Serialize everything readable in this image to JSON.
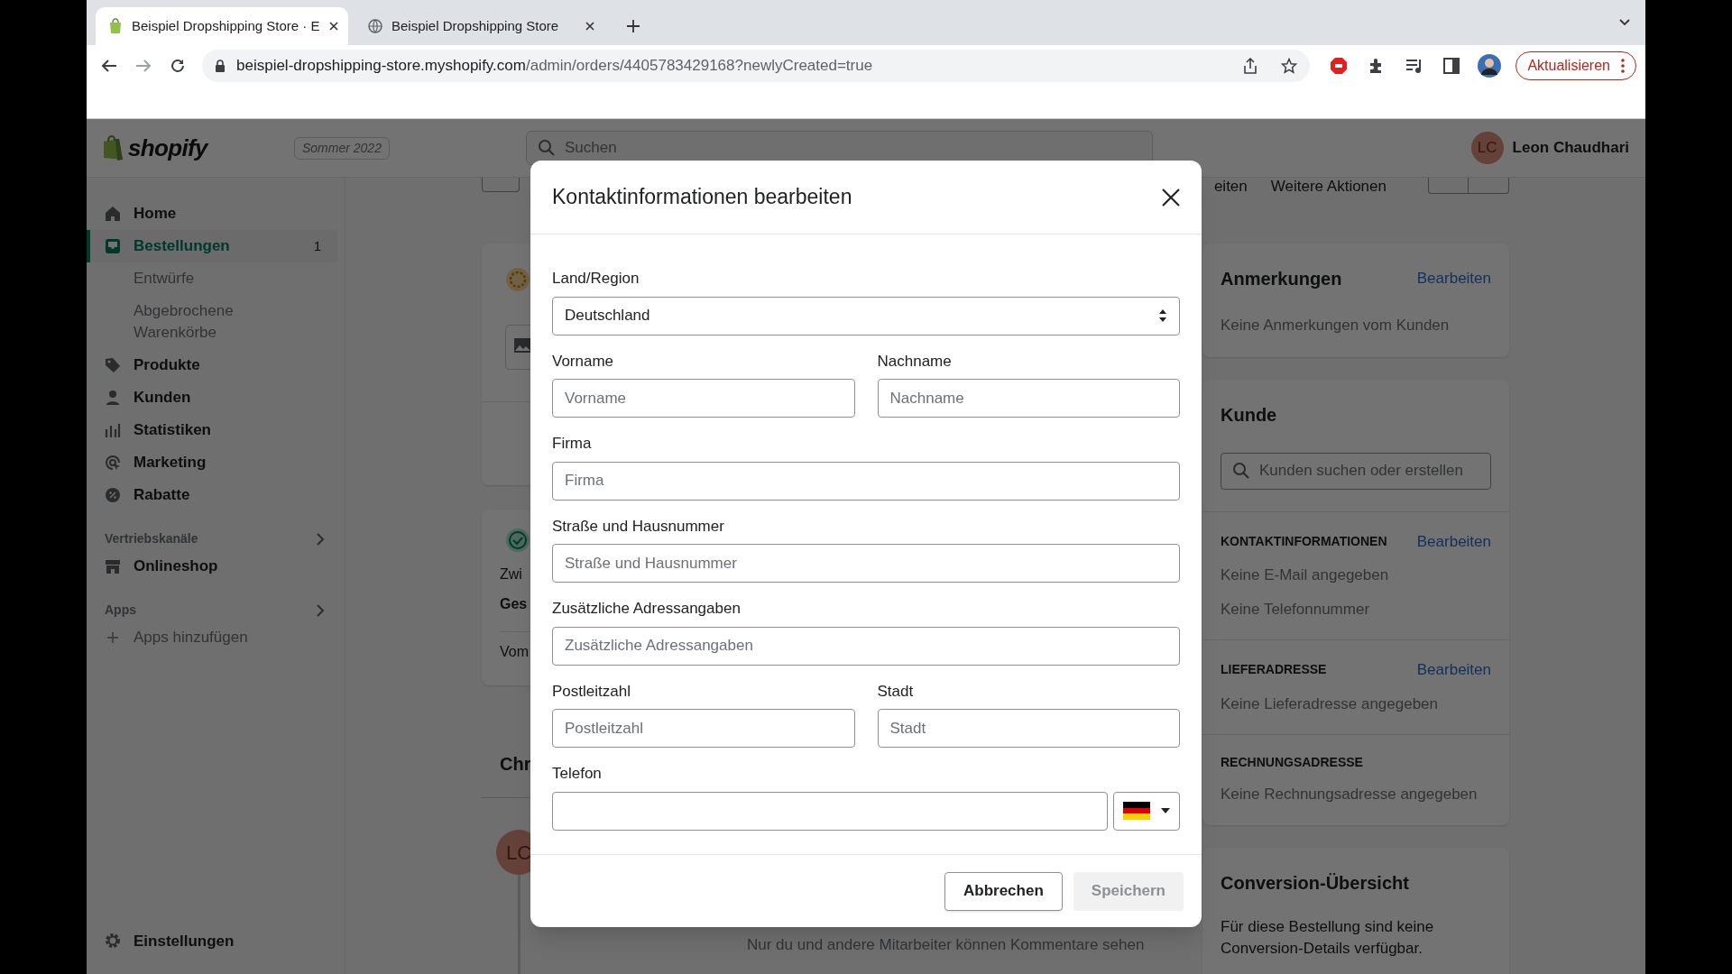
{
  "browser": {
    "tabs": [
      {
        "title": "Beispiel Dropshipping Store · E",
        "selected": true,
        "kind": "shop"
      },
      {
        "title": "Beispiel Dropshipping Store",
        "selected": false,
        "kind": "web"
      }
    ],
    "url_host": "beispiel-dropshipping-store.myshopify.com",
    "url_path": "/admin/orders/4405783429168?newlyCreated=true",
    "update_button": "Aktualisieren"
  },
  "topbar": {
    "logo": "shopify",
    "badge": "Sommer 2022",
    "search_placeholder": "Suchen",
    "user_initials": "LC",
    "user_name": "Leon Chaudhari"
  },
  "sidebar": {
    "items": [
      {
        "label": "Home",
        "selected": false
      },
      {
        "label": "Bestellungen",
        "selected": true,
        "badge": "1",
        "children": [
          {
            "label": "Entwürfe",
            "selected": false
          },
          {
            "label": "Abgebrochene Warenkörbe",
            "selected": false
          }
        ]
      },
      {
        "label": "Produkte",
        "selected": false
      },
      {
        "label": "Kunden",
        "selected": false
      },
      {
        "label": "Statistiken",
        "selected": false
      },
      {
        "label": "Marketing",
        "selected": false
      },
      {
        "label": "Rabatte",
        "selected": false
      }
    ],
    "sections": [
      {
        "title": "Vertriebskanäle",
        "items": [
          {
            "label": "Onlineshop",
            "kind": "nav",
            "selected": false
          }
        ]
      },
      {
        "title": "Apps",
        "items": [
          {
            "label": "Apps hinzufügen",
            "kind": "add",
            "selected": false
          }
        ]
      }
    ],
    "settings": "Einstellungen"
  },
  "header_actions": [
    "eiten",
    "Weitere Aktionen"
  ],
  "left_fragments": {
    "card_2": [
      "Zwi",
      "Ges",
      "Vom"
    ],
    "timeline_heading": "Chr",
    "avatar_initials": "LC",
    "comment_hint": "Nur du und andere Mitarbeiter können Kommentare sehen"
  },
  "notes": {
    "title": "Anmerkungen",
    "action": "Bearbeiten",
    "text": "Keine Anmerkungen vom Kunden"
  },
  "customer": {
    "title": "Kunde",
    "search_placeholder": "Kunden suchen oder erstellen",
    "sections": [
      {
        "heading": "KONTAKTINFORMATIONEN",
        "action": "Bearbeiten",
        "lines": [
          "Keine E-Mail angegeben",
          "Keine Telefonnummer"
        ]
      },
      {
        "heading": "LIEFERADRESSE",
        "action": "Bearbeiten",
        "lines": [
          "Keine Lieferadresse angegeben"
        ]
      },
      {
        "heading": "RECHNUNGSADRESSE",
        "lines": [
          "Keine Rechnungsadresse angegeben"
        ]
      }
    ]
  },
  "conversion": {
    "title": "Conversion-Übersicht",
    "text": "Für diese Bestellung sind keine Conversion-Details verfügbar."
  },
  "modal": {
    "title": "Kontaktinformationen bearbeiten",
    "rows": [
      [
        {
          "label": "Land/Region",
          "kind": "select",
          "value": "Deutschland"
        }
      ],
      [
        {
          "label": "Vorname",
          "kind": "text",
          "placeholder": "Vorname"
        },
        {
          "label": "Nachname",
          "kind": "text",
          "placeholder": "Nachname"
        }
      ],
      [
        {
          "label": "Firma",
          "kind": "text",
          "placeholder": "Firma"
        }
      ],
      [
        {
          "label": "Straße und Hausnummer",
          "kind": "text",
          "placeholder": "Straße und Hausnummer"
        }
      ],
      [
        {
          "label": "Zusätzliche Adressangaben",
          "kind": "text",
          "placeholder": "Zusätzliche Adressangaben"
        }
      ],
      [
        {
          "label": "Postleitzahl",
          "kind": "text",
          "placeholder": "Postleitzahl"
        },
        {
          "label": "Stadt",
          "kind": "text",
          "placeholder": "Stadt"
        }
      ],
      [
        {
          "label": "Telefon",
          "kind": "phone"
        }
      ]
    ],
    "buttons": [
      {
        "label": "Abbrechen",
        "disabled": false
      },
      {
        "label": "Speichern",
        "disabled": true
      }
    ]
  }
}
